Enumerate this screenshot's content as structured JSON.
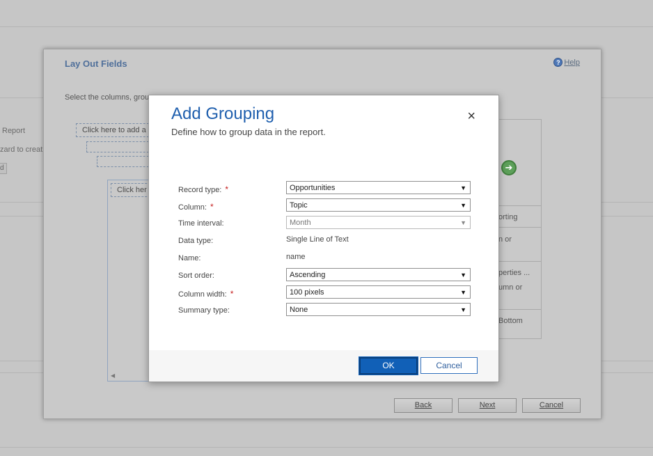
{
  "background": {
    "fragments": [
      "Report",
      "zard to creat",
      "d"
    ]
  },
  "wizard": {
    "title": "Lay Out Fields",
    "help_label": "Help",
    "instructions": "Select the columns, grou",
    "grouping_placeholder": "Click here to add a g",
    "column_placeholder": "Click her",
    "right_panel": {
      "line1": "orting",
      "line2": "n or",
      "line3": "perties ...",
      "line4": "umn or",
      "line5": "Bottom"
    },
    "buttons": {
      "back": "Back",
      "next": "Next",
      "cancel": "Cancel"
    }
  },
  "dialog": {
    "title": "Add Grouping",
    "subtitle": "Define how to group data in the report.",
    "close_glyph": "×",
    "fields": {
      "record_type": {
        "label": "Record type:",
        "value": "Opportunities",
        "required": "*"
      },
      "column": {
        "label": "Column:",
        "value": "Topic",
        "required": "*"
      },
      "time_interval": {
        "label": "Time interval:",
        "value": "Month"
      },
      "data_type": {
        "label": "Data type:",
        "value": "Single Line of Text"
      },
      "name": {
        "label": "Name:",
        "value": "name"
      },
      "sort_order": {
        "label": "Sort order:",
        "value": "Ascending"
      },
      "column_width": {
        "label": "Column width:",
        "value": "100 pixels",
        "required": "*"
      },
      "summary_type": {
        "label": "Summary type:",
        "value": "None"
      }
    },
    "buttons": {
      "ok": "OK",
      "cancel": "Cancel"
    }
  },
  "icons": {
    "caret": "▼",
    "next_arrow": "➔",
    "scroll_left": "◀",
    "help": "?"
  }
}
